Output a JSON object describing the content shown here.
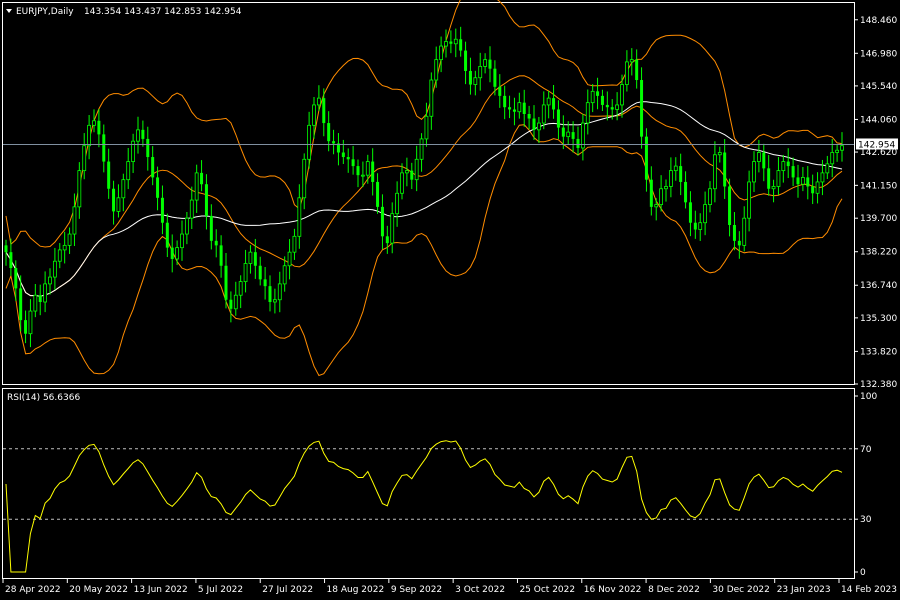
{
  "header": {
    "symbol_label": "EURJPY,Daily",
    "ohlc": "143.354 143.437 142.853 142.954"
  },
  "rsi_header": {
    "label": "RSI(14) 56.6366"
  },
  "colors": {
    "background": "#000000",
    "frame": "#ffffff",
    "bull_bar": "#00ff00",
    "bollinger": "#ff8c00",
    "moving_average": "#ffffff",
    "price_line": "#8090a0",
    "rsi_line": "#ffff00",
    "rsi_levels": "#c0c0c0"
  },
  "chart_data": [
    {
      "type": "candlestick",
      "title": "EURJPY,Daily",
      "price_axis_ticks": [
        "148.460",
        "146.980",
        "145.540",
        "144.060",
        "142.620",
        "141.150",
        "139.700",
        "138.220",
        "136.740",
        "135.300",
        "133.820",
        "132.380"
      ],
      "date_axis_ticks": [
        "28 Apr 2022",
        "20 May 2022",
        "13 Jun 2022",
        "5 Jul 2022",
        "27 Jul 2022",
        "18 Aug 2022",
        "9 Sep 2022",
        "3 Oct 2022",
        "25 Oct 2022",
        "16 Nov 2022",
        "8 Dec 2022",
        "30 Dec 2022",
        "23 Jan 2023",
        "14 Feb 2023"
      ],
      "ylim": [
        132.38,
        149.2
      ],
      "current_price": "142.954",
      "close": [
        138.2,
        137.5,
        136.6,
        135.2,
        134.6,
        135.6,
        136.3,
        136.0,
        136.8,
        137.1,
        137.8,
        138.3,
        138.5,
        139.0,
        140.2,
        141.8,
        142.9,
        143.8,
        144.0,
        143.4,
        142.2,
        141.0,
        140.0,
        140.6,
        141.4,
        142.2,
        143.1,
        143.6,
        143.2,
        142.4,
        141.5,
        140.6,
        139.5,
        138.4,
        137.9,
        138.4,
        139.0,
        139.7,
        140.5,
        141.7,
        141.2,
        139.8,
        138.7,
        138.5,
        137.6,
        136.1,
        135.7,
        136.3,
        136.9,
        137.7,
        138.2,
        137.6,
        137.0,
        136.7,
        136.0,
        136.1,
        136.8,
        137.6,
        138.2,
        138.9,
        140.6,
        142.3,
        143.8,
        144.7,
        145.0,
        143.9,
        143.1,
        143.0,
        142.6,
        142.4,
        142.3,
        142.0,
        141.6,
        141.6,
        142.2,
        141.3,
        140.2,
        138.9,
        138.6,
        139.9,
        140.8,
        141.7,
        141.8,
        141.4,
        142.3,
        143.2,
        144.2,
        145.8,
        146.7,
        147.3,
        147.5,
        147.4,
        147.6,
        147.1,
        146.2,
        145.6,
        145.9,
        146.4,
        146.7,
        146.3,
        145.5,
        145.1,
        144.6,
        144.5,
        144.4,
        144.8,
        144.3,
        144.1,
        143.6,
        143.9,
        144.7,
        145.0,
        144.5,
        143.7,
        143.3,
        143.5,
        143.2,
        142.8,
        143.9,
        144.8,
        145.3,
        145.1,
        144.7,
        144.6,
        144.5,
        144.7,
        145.6,
        146.6,
        146.7,
        145.8,
        143.3,
        141.4,
        140.2,
        140.3,
        141.0,
        141.1,
        141.8,
        142.0,
        141.3,
        140.4,
        139.5,
        139.2,
        139.5,
        140.3,
        141.0,
        142.5,
        142.6,
        141.1,
        139.4,
        138.7,
        138.5,
        139.7,
        141.3,
        142.2,
        142.6,
        141.9,
        141.0,
        141.1,
        141.8,
        142.2,
        142.0,
        141.5,
        141.2,
        141.5,
        141.1,
        140.8,
        141.3,
        141.7,
        142.1,
        142.6,
        142.7,
        142.9
      ]
    },
    {
      "type": "line",
      "title": "RSI(14) 56.6366",
      "axis_ticks": [
        "100",
        "70",
        "30",
        "0"
      ],
      "levels": [
        70,
        30
      ],
      "ylim": [
        0,
        100
      ],
      "value": 56.6366
    }
  ]
}
